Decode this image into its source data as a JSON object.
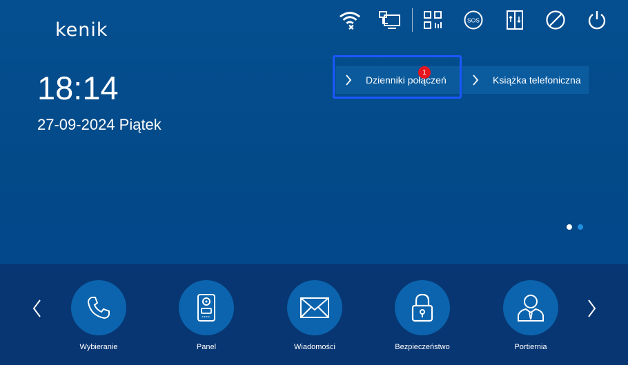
{
  "brand": {
    "logo_text": "kenik"
  },
  "status_bar": {
    "icons": [
      "wifi-disconnected-icon",
      "network-monitor-icon",
      "qr-code-icon",
      "sos-icon",
      "door-elevator-icon",
      "do-not-disturb-icon",
      "power-icon"
    ],
    "sos_label": "SOS"
  },
  "clock": {
    "time": "18:14",
    "date": "27-09-2024 Piątek"
  },
  "quick_links": {
    "call_logs": "Dzienniki połączeń",
    "call_logs_badge": "1",
    "phonebook": "Książka telefoniczna"
  },
  "pager": {
    "pages": 2,
    "active_index": 1
  },
  "dock": {
    "apps": [
      {
        "label": "Wybieranie",
        "icon": "phone-icon"
      },
      {
        "label": "Panel",
        "icon": "door-panel-icon"
      },
      {
        "label": "Wiadomości",
        "icon": "envelope-icon"
      },
      {
        "label": "Bezpieczeństwo",
        "icon": "padlock-icon"
      },
      {
        "label": "Portiernia",
        "icon": "concierge-icon"
      }
    ]
  },
  "colors": {
    "background": "#034b8a",
    "dock_background": "#083672",
    "app_circle": "#0b64ad",
    "highlight_border": "#1b58ff",
    "badge": "#e8151e",
    "dot_active": "#1f8fe0",
    "dot_inactive": "#ffffff"
  }
}
